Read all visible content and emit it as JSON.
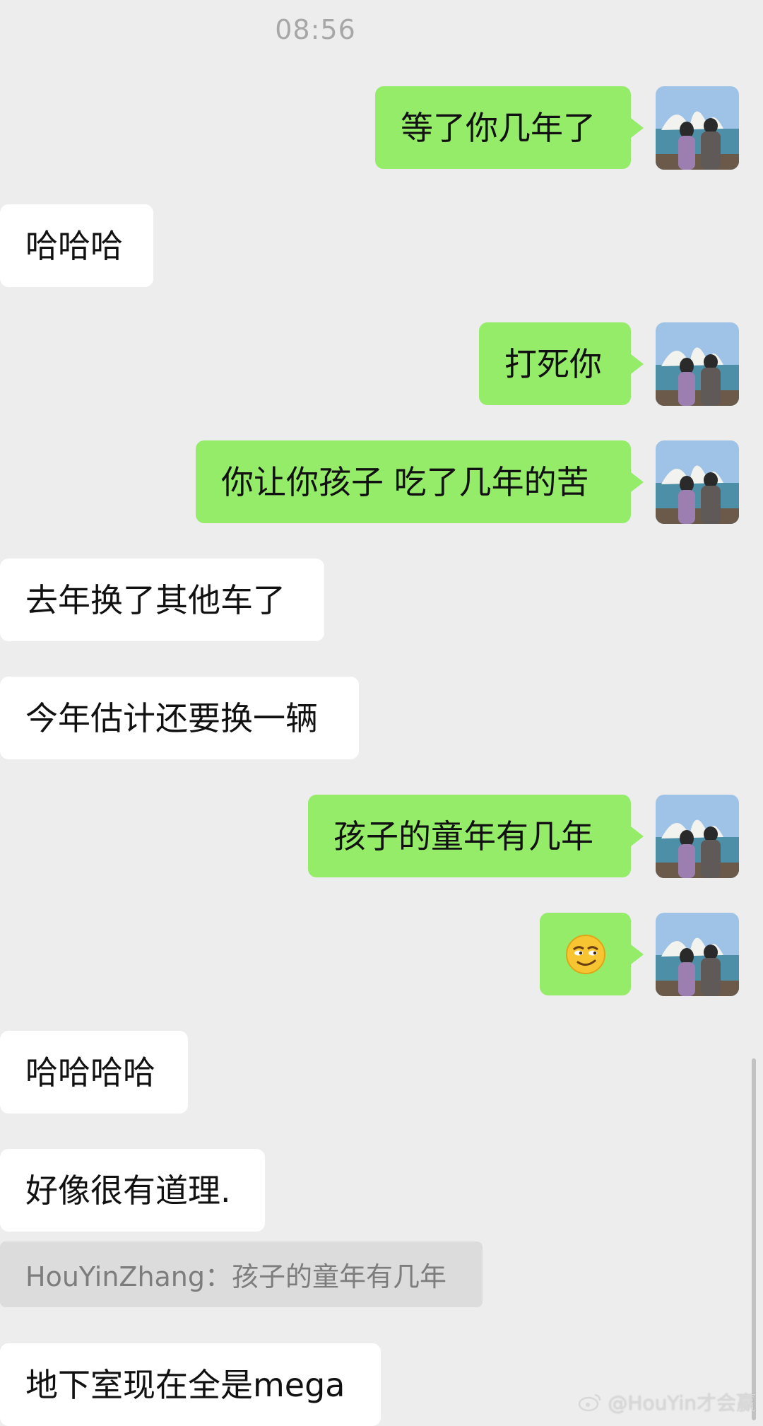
{
  "timestamp": "08:56",
  "messages": [
    {
      "side": "out",
      "text": "等了你几年了"
    },
    {
      "side": "in",
      "text": "哈哈哈"
    },
    {
      "side": "out",
      "text": "打死你"
    },
    {
      "side": "out",
      "text": "你让你孩子 吃了几年的苦"
    },
    {
      "side": "in",
      "text": "去年换了其他车了"
    },
    {
      "side": "in",
      "text": "今年估计还要换一辆"
    },
    {
      "side": "out",
      "text": "孩子的童年有几年"
    },
    {
      "side": "out",
      "emoji": "smirk-emoji"
    },
    {
      "side": "in",
      "text": "哈哈哈哈"
    },
    {
      "side": "in",
      "text": "好像很有道理."
    },
    {
      "side": "in",
      "text": "地下室现在全是mega"
    }
  ],
  "quote": {
    "text": "HouYinZhang：孩子的童年有几年"
  },
  "watermark": {
    "text": "@HouYin才会赢",
    "icon": "weibo-icon"
  },
  "colors": {
    "outgoing": "#95ec69",
    "incoming": "#ffffff",
    "background": "#ededed",
    "quote_bg": "#dcdcdc"
  }
}
